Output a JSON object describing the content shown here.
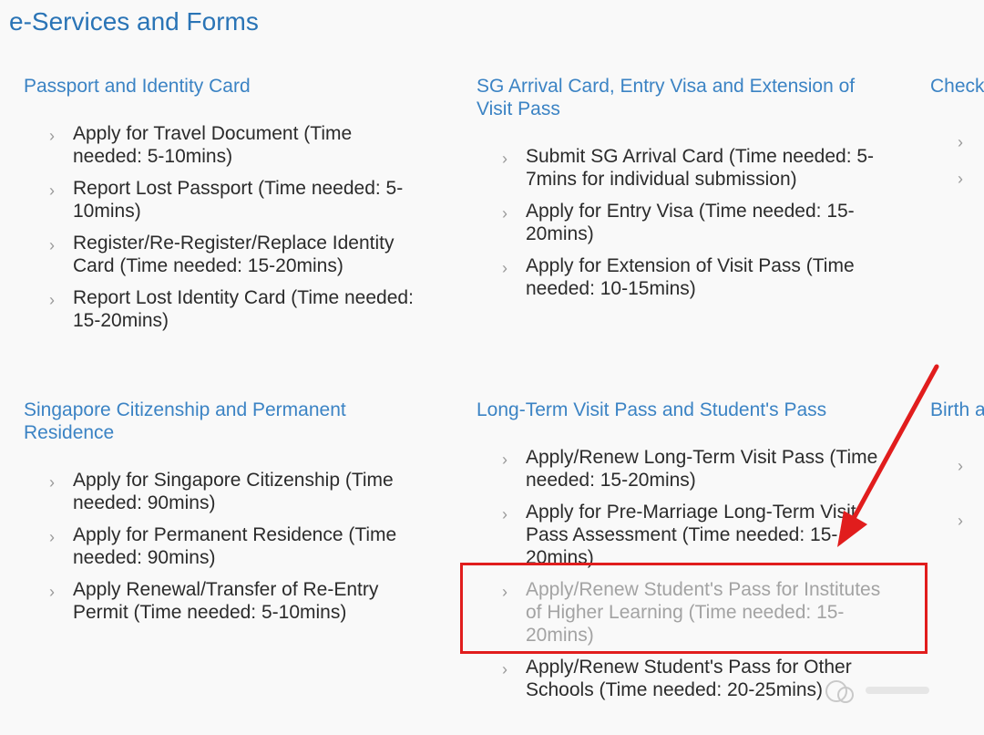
{
  "page": {
    "title": "e-Services and Forms"
  },
  "sections": [
    {
      "title": "Passport and Identity Card",
      "links": [
        "Apply for Travel Document (Time needed: 5-10mins)",
        "Report Lost Passport (Time needed: 5-10mins)",
        "Register/Re-Register/Replace Identity Card (Time needed: 15-20mins)",
        "Report Lost Identity Card (Time needed: 15-20mins)"
      ]
    },
    {
      "title": "SG Arrival Card, Entry Visa and Extension of Visit Pass",
      "links": [
        "Submit SG Arrival Card (Time needed: 5-7mins for individual submission)",
        "Apply for Entry Visa (Time needed: 15-20mins)",
        "Apply for Extension of Visit Pass (Time needed: 10-15mins)"
      ]
    },
    {
      "title": "Check"
    },
    {
      "title": "Singapore Citizenship and Permanent Residence",
      "links": [
        "Apply for Singapore Citizenship (Time needed: 90mins)",
        "Apply for Permanent Residence (Time needed: 90mins)",
        "Apply Renewal/Transfer of Re-Entry Permit (Time needed: 5-10mins)"
      ]
    },
    {
      "title": "Long-Term Visit Pass and Student's Pass",
      "links": [
        "Apply/Renew Long-Term Visit Pass (Time needed: 15-20mins)",
        "Apply for Pre-Marriage Long-Term Visit Pass Assessment (Time needed: 15-20mins)",
        "Apply/Renew Student's Pass for Institutes of Higher Learning (Time needed: 15-20mins)",
        "Apply/Renew Student's Pass for Other Schools (Time needed: 20-25mins)"
      ]
    },
    {
      "title": "Birth a"
    }
  ],
  "annotation": {
    "box_color": "#e11d1d",
    "arrow_color": "#e11d1d"
  }
}
